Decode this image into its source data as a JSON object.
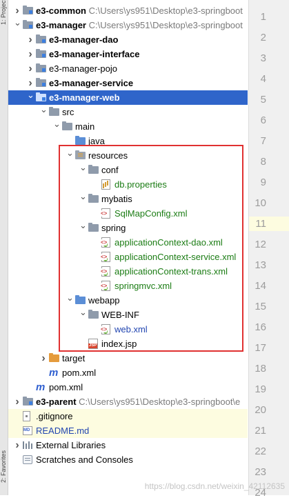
{
  "side_stripe": {
    "top_tab": "1: Project",
    "bottom_tab": "2: Favorites"
  },
  "tree": [
    {
      "label": "e3-common",
      "path": "C:\\Users\\ys951\\Desktop\\e3-springboot",
      "bold": true,
      "depth": 0,
      "arrow": "right",
      "icon": "module-folder",
      "name": "e3-common"
    },
    {
      "label": "e3-manager",
      "path": "C:\\Users\\ys951\\Desktop\\e3-springboot",
      "bold": true,
      "depth": 0,
      "arrow": "down",
      "icon": "module-folder",
      "name": "e3-manager"
    },
    {
      "label": "e3-manager-dao",
      "bold": true,
      "depth": 1,
      "arrow": "right",
      "icon": "module-folder",
      "name": "e3-manager-dao"
    },
    {
      "label": "e3-manager-interface",
      "bold": true,
      "depth": 1,
      "arrow": "right",
      "icon": "module-folder",
      "name": "e3-manager-interface"
    },
    {
      "label": "e3-manager-pojo",
      "bold": false,
      "depth": 1,
      "arrow": "right",
      "icon": "module-folder",
      "name": "e3-manager-pojo"
    },
    {
      "label": "e3-manager-service",
      "bold": true,
      "depth": 1,
      "arrow": "right",
      "icon": "module-folder",
      "name": "e3-manager-service"
    },
    {
      "label": "e3-manager-web",
      "bold": true,
      "depth": 1,
      "arrow": "down",
      "icon": "module-folder",
      "selected": true,
      "name": "e3-manager-web"
    },
    {
      "label": "src",
      "depth": 2,
      "arrow": "down",
      "icon": "folder",
      "name": "src"
    },
    {
      "label": "main",
      "depth": 3,
      "arrow": "down",
      "icon": "folder",
      "name": "main"
    },
    {
      "label": "java",
      "depth": 4,
      "arrow": "",
      "icon": "source-folder",
      "name": "java"
    },
    {
      "label": "resources",
      "depth": 4,
      "arrow": "down",
      "icon": "resource-folder",
      "name": "resources"
    },
    {
      "label": "conf",
      "depth": 5,
      "arrow": "down",
      "icon": "folder",
      "name": "conf"
    },
    {
      "label": "db.properties",
      "depth": 6,
      "arrow": "",
      "icon": "properties-file",
      "color": "green",
      "name": "db-properties"
    },
    {
      "label": "mybatis",
      "depth": 5,
      "arrow": "down",
      "icon": "folder",
      "name": "mybatis"
    },
    {
      "label": "SqlMapConfig.xml",
      "depth": 6,
      "arrow": "",
      "icon": "xml-file",
      "color": "green",
      "name": "sqlmapconfig-xml"
    },
    {
      "label": "spring",
      "depth": 5,
      "arrow": "down",
      "icon": "folder",
      "name": "spring"
    },
    {
      "label": "applicationContext-dao.xml",
      "depth": 6,
      "arrow": "",
      "icon": "spring-xml-file",
      "color": "green",
      "name": "applicationcontext-dao-xml"
    },
    {
      "label": "applicationContext-service.xml",
      "depth": 6,
      "arrow": "",
      "icon": "spring-xml-file",
      "color": "green",
      "name": "applicationcontext-service-xml"
    },
    {
      "label": "applicationContext-trans.xml",
      "depth": 6,
      "arrow": "",
      "icon": "spring-xml-file",
      "color": "green",
      "name": "applicationcontext-trans-xml"
    },
    {
      "label": "springmvc.xml",
      "depth": 6,
      "arrow": "",
      "icon": "spring-xml-file",
      "color": "green",
      "name": "springmvc-xml"
    },
    {
      "label": "webapp",
      "depth": 4,
      "arrow": "down",
      "icon": "source-folder",
      "name": "webapp"
    },
    {
      "label": "WEB-INF",
      "depth": 5,
      "arrow": "down",
      "icon": "folder",
      "name": "web-inf"
    },
    {
      "label": "web.xml",
      "depth": 6,
      "arrow": "",
      "icon": "spring-xml-file",
      "color": "blue",
      "name": "web-xml"
    },
    {
      "label": "index.jsp",
      "depth": 5,
      "arrow": "",
      "icon": "jsp-file",
      "name": "index-jsp"
    },
    {
      "label": "target",
      "depth": 2,
      "arrow": "right",
      "icon": "excluded-folder",
      "name": "target"
    },
    {
      "label": "pom.xml",
      "depth": 2,
      "arrow": "",
      "icon": "maven-file",
      "name": "pom-xml-web"
    },
    {
      "label": "pom.xml",
      "depth": 1,
      "arrow": "",
      "icon": "maven-file",
      "name": "pom-xml-manager"
    },
    {
      "label": "e3-parent",
      "path": "C:\\Users\\ys951\\Desktop\\e3-springboot\\e",
      "bold": true,
      "depth": 0,
      "arrow": "right",
      "icon": "module-folder",
      "name": "e3-parent"
    },
    {
      "label": ".gitignore",
      "depth": 0,
      "arrow": "",
      "icon": "git-file",
      "highlight": true,
      "name": "gitignore"
    },
    {
      "label": "README.md",
      "depth": 0,
      "arrow": "",
      "icon": "md-file",
      "color": "blue",
      "highlight": true,
      "name": "readme-md"
    },
    {
      "label": "External Libraries",
      "depth": 0,
      "arrow": "right",
      "icon": "library",
      "name": "external-libraries"
    },
    {
      "label": "Scratches and Consoles",
      "depth": 0,
      "arrow": "",
      "icon": "scratches",
      "name": "scratches-and-consoles"
    }
  ],
  "gutter": {
    "line_numbers": [
      "1",
      "2",
      "3",
      "4",
      "5",
      "6",
      "7",
      "8",
      "9",
      "10",
      "11",
      "12",
      "13",
      "14",
      "15",
      "16",
      "17",
      "18",
      "19",
      "20",
      "21",
      "22",
      "23",
      "24"
    ],
    "current_line": "11"
  },
  "watermark": "https://blog.csdn.net/weixin_42112635"
}
